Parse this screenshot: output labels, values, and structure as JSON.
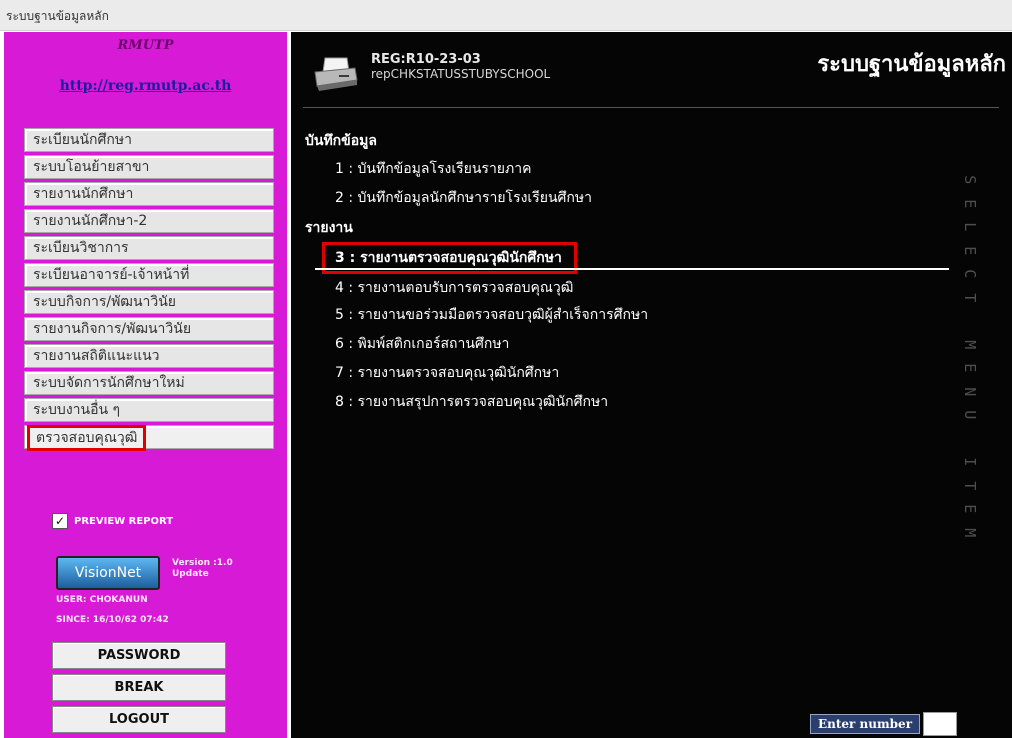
{
  "window": {
    "title": "ระบบฐานข้อมูลหลัก"
  },
  "sidebar": {
    "org": "RMUTP",
    "link": "http://reg.rmutp.ac.th",
    "menu": [
      "ระเบียนนักศึกษา",
      "ระบบโอนย้ายสาขา",
      "รายงานนักศึกษา",
      "รายงานนักศึกษา-2",
      "ระเบียนวิชาการ",
      "ระเบียนอาจารย์-เจ้าหน้าที่",
      "ระบบกิจการ/พัฒนาวินัย",
      "รายงานกิจการ/พัฒนาวินัย",
      "รายงานสถิติแนะแนว",
      "ระบบจัดการนักศึกษาใหม่",
      "ระบบงานอื่น ๆ",
      "ตรวจสอบคุณวุฒิ"
    ],
    "preview_label": "PREVIEW REPORT",
    "preview_checked": true,
    "brand": "VisionNet",
    "version_line1": "Version :1.0",
    "version_line2": "Update",
    "user": "USER: CHOKANUN",
    "since": "SINCE: 16/10/62 07:42",
    "buttons": {
      "password": "PASSWORD",
      "break": "BREAK",
      "logout": "LOGOUT"
    }
  },
  "header": {
    "reg_code": "REG:R10-23-03",
    "report_name": "repCHKSTATUSSTUBYSCHOOL",
    "title": "ระบบฐานข้อมูลหลัก"
  },
  "sections": {
    "record": {
      "title": "บันทึกข้อมูล",
      "items": [
        "1 : บันทึกข้อมูลโรงเรียนรายภาค",
        "2 : บันทึกข้อมูลนักศึกษารายโรงเรียนศึกษา"
      ]
    },
    "report": {
      "title": "รายงาน",
      "items": [
        "3 : รายงานตรวจสอบคุณวุฒินักศึกษา",
        "4 : รายงานตอบรับการตรวจสอบคุณวุฒิ",
        "5 : รายงานขอร่วมมือตรวจสอบวุฒิผู้สำเร็จการศึกษา",
        "6 : พิมพ์สติกเกอร์สถานศึกษา",
        "7 : รายงานตรวจสอบคุณวุฒินักศึกษา",
        "8 : รายงานสรุปการตรวจสอบคุณวุฒินักศึกษา"
      ]
    }
  },
  "vertical_text": [
    "S",
    "E",
    "L",
    "E",
    "C",
    "T",
    " ",
    "M",
    "E",
    "N",
    "U",
    " ",
    "I",
    "T",
    "E",
    "M"
  ],
  "footer": {
    "enter_label": "Enter number",
    "enter_value": ""
  }
}
